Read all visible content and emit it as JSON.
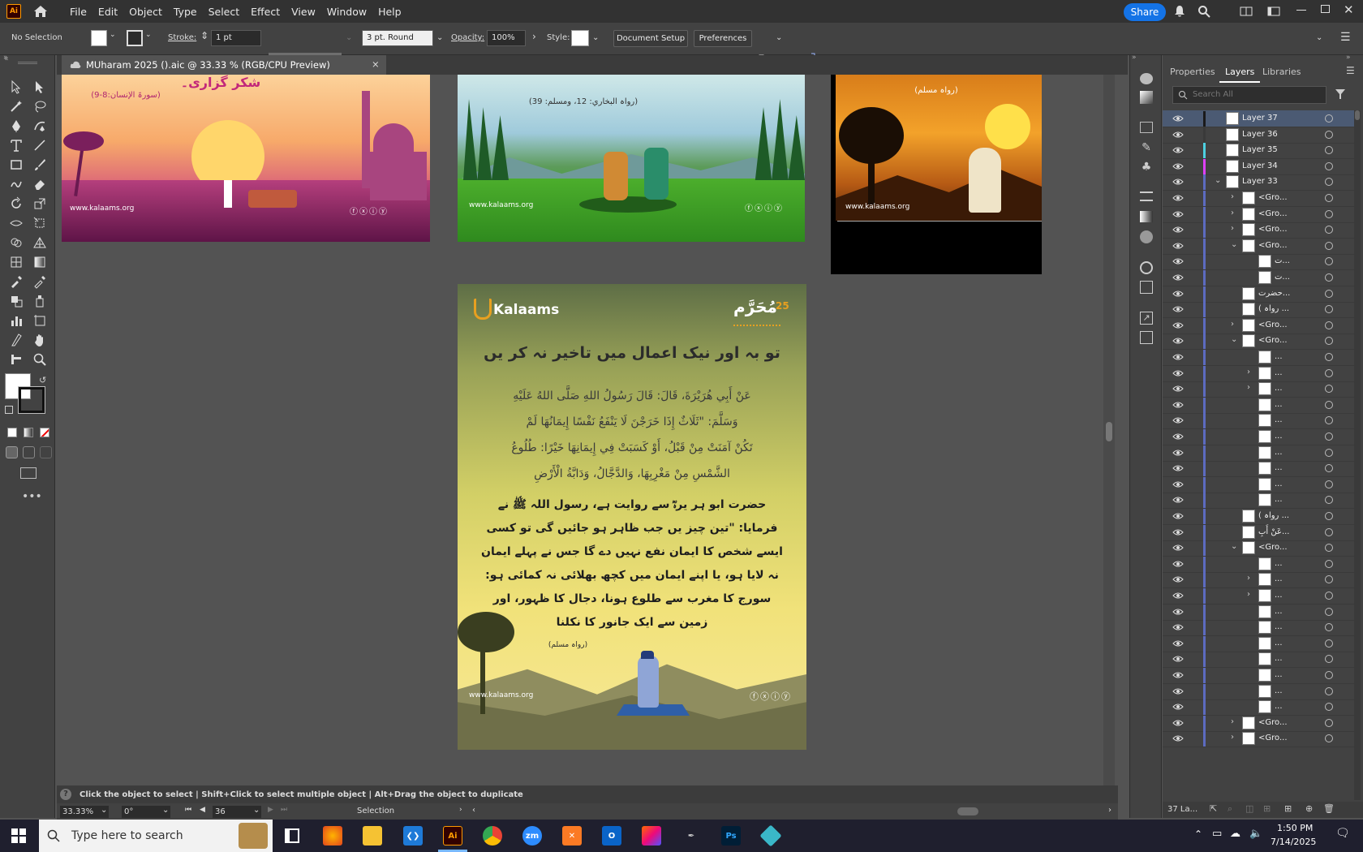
{
  "app": {
    "logo": "Ai",
    "menu": [
      "File",
      "Edit",
      "Object",
      "Type",
      "Select",
      "Effect",
      "View",
      "Window",
      "Help"
    ],
    "share_label": "Share"
  },
  "control_bar": {
    "selection": "No Selection",
    "stroke_label": "Stroke:",
    "stroke_value": "1 pt",
    "brush_value": "3 pt. Round",
    "opacity_label": "Opacity:",
    "opacity_value": "100%",
    "style_label": "Style:",
    "document_setup": "Document Setup",
    "preferences": "Preferences"
  },
  "document": {
    "tab_title": "MUharam 2025 ().aic @ 33.33 % (RGB/CPU Preview)",
    "close": "×"
  },
  "artboards": {
    "top_left": {
      "title": "شکر گزاری۔",
      "ref": "(سورۃ الإنسان:8-9)",
      "url": "www.kalaams.org"
    },
    "top_mid": {
      "ref": "(رواہ البخاري: 12، ومسلم: 39)",
      "url": "www.kalaams.org"
    },
    "top_right": {
      "ref": "(رواہ مسلم)",
      "url": "www.kalaams.org"
    },
    "main": {
      "brand": "Kalaams",
      "badge_number": "25",
      "badge_word": "مُحَرَّم",
      "heading": "تو بہ اور نیک اعمال میں تاخیر نہ کر یں",
      "arabic_lines": [
        "عَنْ أَبِي هُرَيْرَةَ، قَالَ: قَالَ رَسُولُ اللهِ صَلَّى اللهُ عَلَيْهِ",
        "وَسَلَّمَ: \"ثَلَاثٌ إِذَا خَرَجْنَ لَا يَنْفَعُ نَفْسًا إِيمَانُهَا لَمْ",
        "تَكُنْ آمَنَتْ مِنْ قَبْلُ، أَوْ كَسَبَتْ فِي إِيمَانِهَا خَيْرًا: طُلُوعُ",
        "الشَّمْسِ مِنْ مَغْرِبِهَا، وَالدَّجَّالُ، وَدَابَّةُ الْأَرْضِ"
      ],
      "urdu_lines": [
        "حضرت ابو ہر یرہؓ سے روایت ہے، رسول اللہ ﷺ نے",
        "فرمایا: \"تین چیز یں جب ظاہر ہو جائیں گی تو کسی",
        "ایسے شخص کا ایمان نفع نہیں دے گا جس نے پہلے ایمان",
        "نہ لایا ہو، یا اپنے ایمان میں کچھ بھلائی نہ کمائی ہو:",
        "سورج کا مغرب سے طلوع ہونا، دجال کا ظہور، اور",
        "زمین سے ایک جانور کا نکلنا"
      ],
      "ref": "(رواہ مسلم)",
      "url": "www.kalaams.org"
    }
  },
  "hint": {
    "text": "Click the object to select  |  Shift+Click to select multiple object  |  Alt+Drag the object to duplicate"
  },
  "status": {
    "zoom": "33.33%",
    "rotation": "0°",
    "artboard": "36",
    "tool": "Selection"
  },
  "panel": {
    "tabs": [
      "Properties",
      "Layers",
      "Libraries"
    ],
    "search_placeholder": "Search All",
    "footer_count": "37 La...",
    "layers": [
      {
        "name": "Layer 37",
        "color": "#1a1a1a"
      },
      {
        "name": "Layer 36",
        "color": "#3a3a3a"
      },
      {
        "name": "Layer 35",
        "color": "#4dd0e1"
      },
      {
        "name": "Layer 34",
        "color": "#e040fb"
      },
      {
        "name": "Layer 33",
        "color": "#5c6bc0"
      },
      {
        "name": "<Gro...",
        "color": "#5c6bc0"
      },
      {
        "name": "<Gro...",
        "color": "#5c6bc0"
      },
      {
        "name": "<Gro...",
        "color": "#5c6bc0"
      },
      {
        "name": "<Gro...",
        "color": "#5c6bc0"
      },
      {
        "name": "ت...",
        "color": "#5c6bc0"
      },
      {
        "name": "ت...",
        "color": "#5c6bc0"
      },
      {
        "name": "حضرت...",
        "color": "#5c6bc0"
      },
      {
        "name": "( رواہ ...",
        "color": "#5c6bc0"
      },
      {
        "name": "<Gro...",
        "color": "#5c6bc0"
      },
      {
        "name": "<Gro...",
        "color": "#5c6bc0"
      },
      {
        "name": "...",
        "color": "#5c6bc0"
      },
      {
        "name": "...",
        "color": "#5c6bc0"
      },
      {
        "name": "...",
        "color": "#5c6bc0"
      },
      {
        "name": "...",
        "color": "#5c6bc0"
      },
      {
        "name": "...",
        "color": "#5c6bc0"
      },
      {
        "name": "...",
        "color": "#5c6bc0"
      },
      {
        "name": "...",
        "color": "#5c6bc0"
      },
      {
        "name": "...",
        "color": "#5c6bc0"
      },
      {
        "name": "...",
        "color": "#5c6bc0"
      },
      {
        "name": "...",
        "color": "#5c6bc0"
      },
      {
        "name": "( رواہ ...",
        "color": "#5c6bc0"
      },
      {
        "name": "عَنْ أَبِ...",
        "color": "#5c6bc0"
      },
      {
        "name": "<Gro...",
        "color": "#5c6bc0"
      },
      {
        "name": "...",
        "color": "#5c6bc0"
      },
      {
        "name": "...",
        "color": "#5c6bc0"
      },
      {
        "name": "...",
        "color": "#5c6bc0"
      },
      {
        "name": "...",
        "color": "#5c6bc0"
      },
      {
        "name": "...",
        "color": "#5c6bc0"
      },
      {
        "name": "...",
        "color": "#5c6bc0"
      },
      {
        "name": "...",
        "color": "#5c6bc0"
      },
      {
        "name": "...",
        "color": "#5c6bc0"
      },
      {
        "name": "...",
        "color": "#5c6bc0"
      },
      {
        "name": "...",
        "color": "#5c6bc0"
      },
      {
        "name": "<Gro...",
        "color": "#5c6bc0"
      },
      {
        "name": "<Gro...",
        "color": "#5c6bc0"
      }
    ]
  },
  "taskbar": {
    "search_placeholder": "Type here to search",
    "time": "1:50 PM",
    "date": "7/14/2025",
    "apps": [
      "zm",
      "Ps"
    ]
  },
  "colors": {
    "accent": "#1473e6",
    "selected_layer": "#4b5a73",
    "brand_gold": "#e8a020"
  }
}
